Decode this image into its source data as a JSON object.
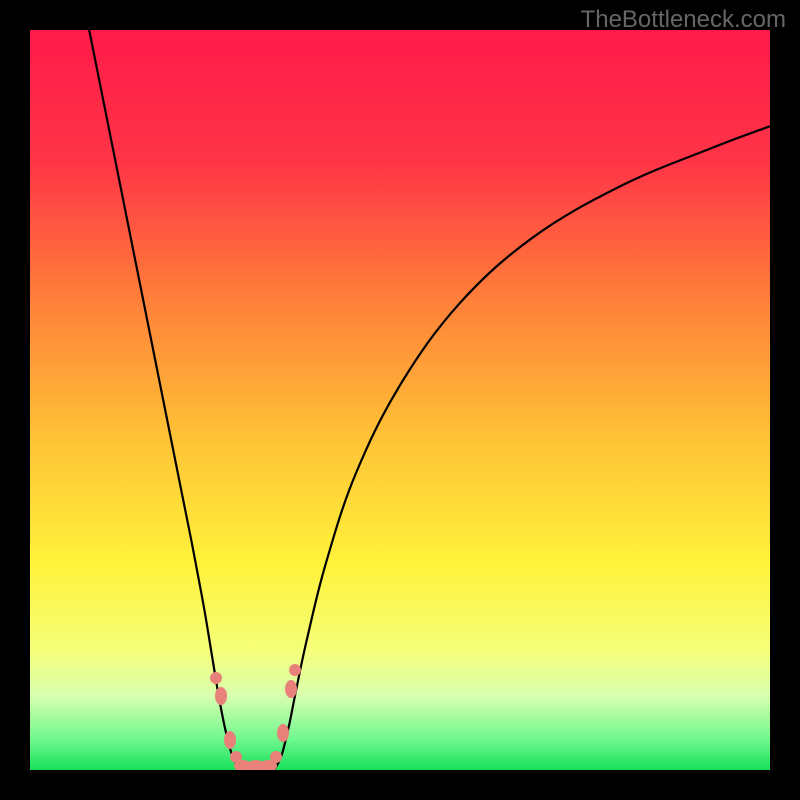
{
  "attribution": "TheBottleneck.com",
  "chart_data": {
    "type": "line",
    "title": "",
    "xlabel": "",
    "ylabel": "",
    "xlim": [
      0,
      100
    ],
    "ylim": [
      0,
      100
    ],
    "gradient_stops": [
      {
        "pos": 0,
        "color": "#ff1a4a"
      },
      {
        "pos": 18,
        "color": "#ff3547"
      },
      {
        "pos": 35,
        "color": "#ff7a3a"
      },
      {
        "pos": 55,
        "color": "#ffc236"
      },
      {
        "pos": 72,
        "color": "#fff23a"
      },
      {
        "pos": 84,
        "color": "#f5ff7a"
      },
      {
        "pos": 90,
        "color": "#d8ffb0"
      },
      {
        "pos": 96,
        "color": "#6cf78c"
      },
      {
        "pos": 100,
        "color": "#18e05c"
      }
    ],
    "series": [
      {
        "name": "left-arm",
        "points": [
          {
            "x": 8.0,
            "y": 100.0
          },
          {
            "x": 10.0,
            "y": 90.0
          },
          {
            "x": 12.0,
            "y": 80.0
          },
          {
            "x": 14.0,
            "y": 70.0
          },
          {
            "x": 16.0,
            "y": 60.0
          },
          {
            "x": 18.0,
            "y": 50.0
          },
          {
            "x": 20.0,
            "y": 40.0
          },
          {
            "x": 22.0,
            "y": 30.0
          },
          {
            "x": 23.5,
            "y": 22.0
          },
          {
            "x": 24.5,
            "y": 16.0
          },
          {
            "x": 25.5,
            "y": 10.0
          },
          {
            "x": 26.5,
            "y": 5.0
          },
          {
            "x": 27.5,
            "y": 1.5
          },
          {
            "x": 28.5,
            "y": 0.0
          }
        ]
      },
      {
        "name": "right-arm",
        "points": [
          {
            "x": 33.0,
            "y": 0.0
          },
          {
            "x": 34.0,
            "y": 2.0
          },
          {
            "x": 35.0,
            "y": 6.0
          },
          {
            "x": 36.0,
            "y": 11.0
          },
          {
            "x": 37.5,
            "y": 18.0
          },
          {
            "x": 40.0,
            "y": 28.0
          },
          {
            "x": 44.0,
            "y": 40.0
          },
          {
            "x": 50.0,
            "y": 52.0
          },
          {
            "x": 58.0,
            "y": 63.0
          },
          {
            "x": 68.0,
            "y": 72.0
          },
          {
            "x": 80.0,
            "y": 79.0
          },
          {
            "x": 92.0,
            "y": 84.0
          },
          {
            "x": 100.0,
            "y": 87.0
          }
        ]
      }
    ],
    "valley_floor": {
      "x1": 28.5,
      "x2": 33.0,
      "y": 0.0
    },
    "markers": [
      {
        "x": 25.2,
        "y": 12.5,
        "shape": "round"
      },
      {
        "x": 25.8,
        "y": 10.0,
        "shape": "tall"
      },
      {
        "x": 27.0,
        "y": 4.0,
        "shape": "tall"
      },
      {
        "x": 27.8,
        "y": 1.8,
        "shape": "round"
      },
      {
        "x": 28.8,
        "y": 0.5,
        "shape": "wide"
      },
      {
        "x": 30.5,
        "y": 0.5,
        "shape": "wide"
      },
      {
        "x": 32.2,
        "y": 0.5,
        "shape": "wide"
      },
      {
        "x": 33.2,
        "y": 1.8,
        "shape": "round"
      },
      {
        "x": 34.2,
        "y": 5.0,
        "shape": "tall"
      },
      {
        "x": 35.3,
        "y": 11.0,
        "shape": "tall"
      },
      {
        "x": 35.8,
        "y": 13.5,
        "shape": "round"
      }
    ]
  }
}
